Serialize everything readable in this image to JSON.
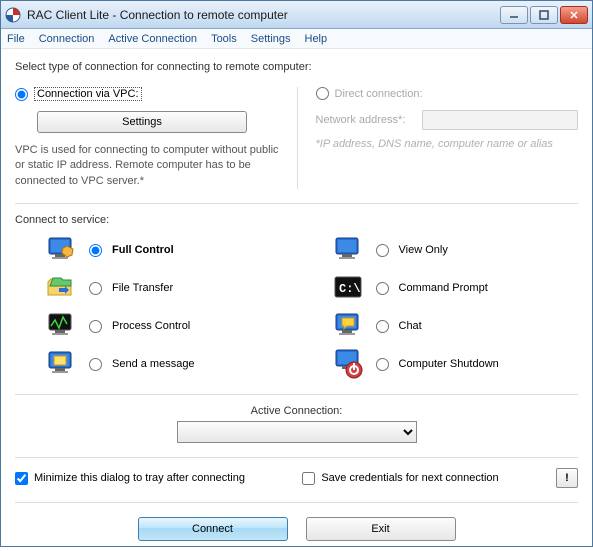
{
  "window": {
    "title": "RAC Client Lite - Connection to remote computer"
  },
  "menu": {
    "file": "File",
    "connection": "Connection",
    "active": "Active Connection",
    "tools": "Tools",
    "settings": "Settings",
    "help": "Help"
  },
  "instruction": "Select type of connection for connecting to remote computer:",
  "conn": {
    "vpc": {
      "label": "Connection via VPC:",
      "settings_btn": "Settings",
      "desc": "VPC is used for connecting to computer without public or static IP address. Remote computer has to be connected to VPC server.*"
    },
    "direct": {
      "label": "Direct connection:",
      "net_label": "Network address*:",
      "net_value": "",
      "hint": "*IP address, DNS name, computer name or alias"
    }
  },
  "services": {
    "heading": "Connect to service:",
    "full_control": "Full Control",
    "view_only": "View Only",
    "file_transfer": "File Transfer",
    "command_prompt": "Command Prompt",
    "process_control": "Process Control",
    "chat": "Chat",
    "send_msg": "Send a message",
    "shutdown": "Computer Shutdown"
  },
  "active_conn": {
    "label": "Active Connection:",
    "value": ""
  },
  "options": {
    "minimize": "Minimize this dialog to tray after connecting",
    "save_creds": "Save credentials for next connection",
    "bang": "!"
  },
  "buttons": {
    "connect": "Connect",
    "exit": "Exit"
  }
}
